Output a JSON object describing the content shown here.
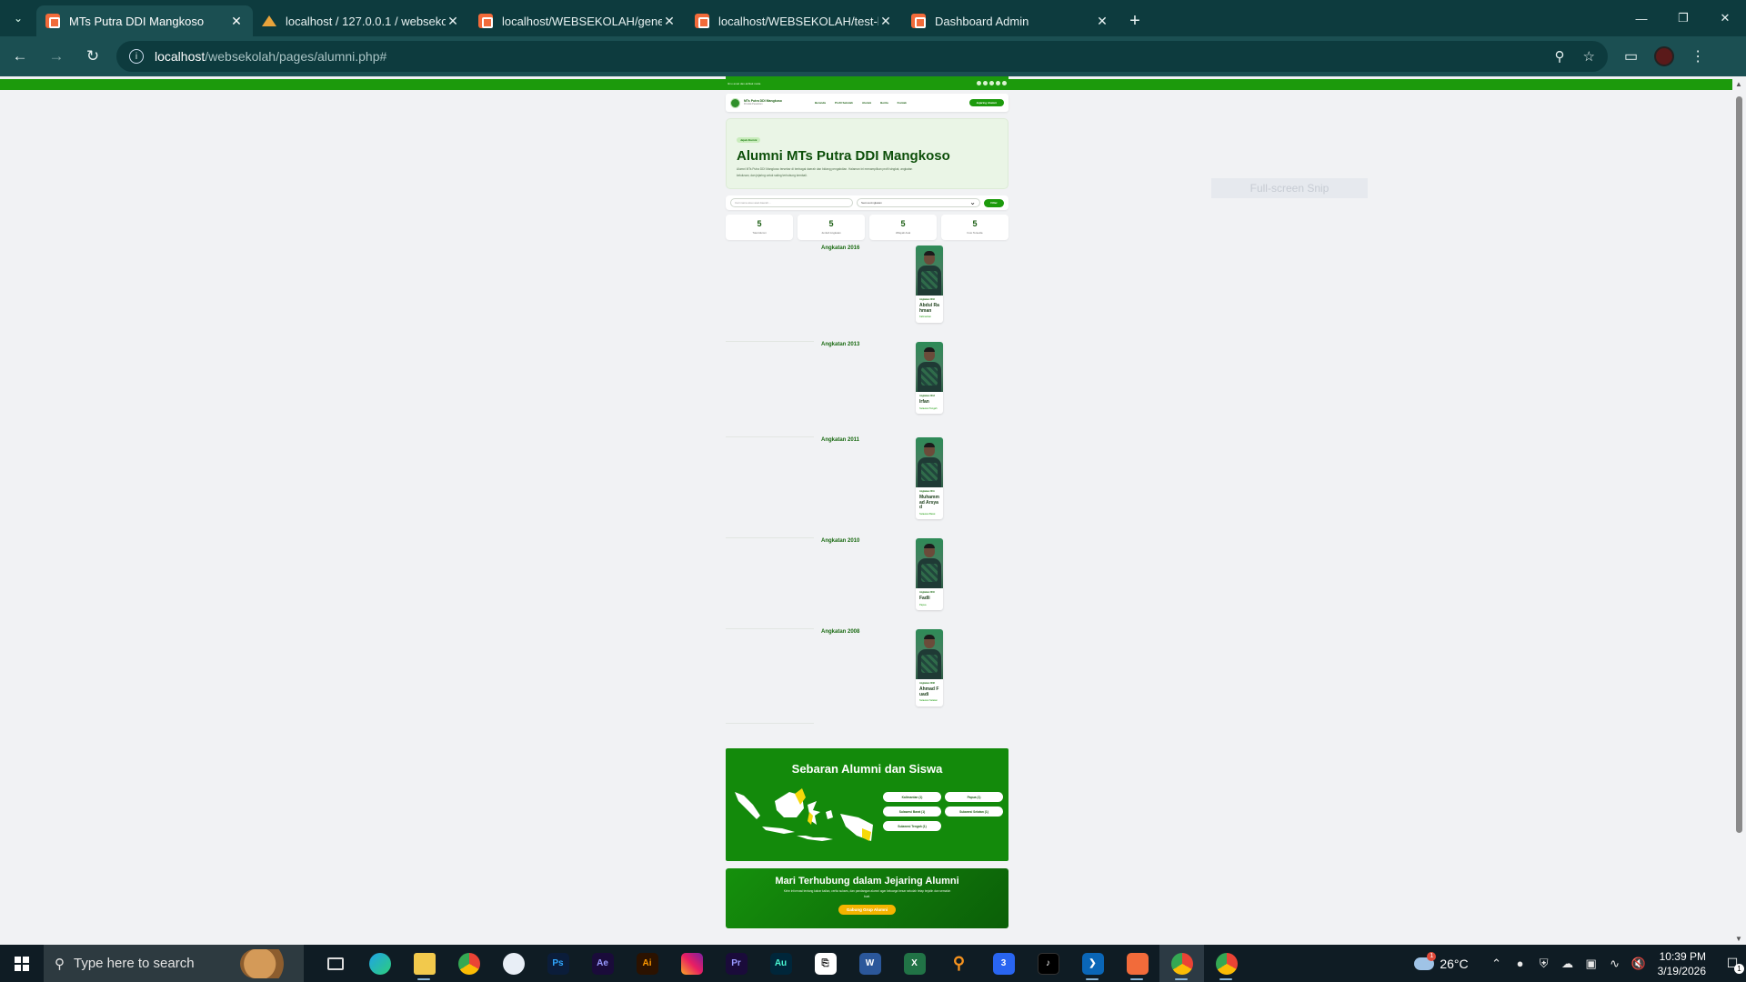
{
  "browser": {
    "tabs": [
      {
        "title": "MTs Putra DDI Mangkoso",
        "icon": "xampp-icon"
      },
      {
        "title": "localhost / 127.0.0.1 / websekolah",
        "icon": "phpmyadmin-icon"
      },
      {
        "title": "localhost/WEBSEKOLAH/generate",
        "icon": "xampp-icon"
      },
      {
        "title": "localhost/WEBSEKOLAH/test-koneksi",
        "icon": "xampp-icon"
      },
      {
        "title": "Dashboard Admin",
        "icon": "xampp-icon"
      }
    ],
    "url_host": "localhost",
    "url_path": "/websekolah/pages/alumni.php#",
    "ghost_overlay": "Full-screen Snip"
  },
  "site": {
    "topbar_tagline": "Ilmu amal dan akhlak mulia",
    "brand_name": "MTs Putra DDI Mangkoso",
    "brand_sub": "Pondok Pesantren",
    "menu": [
      "Beranda",
      "Profil Sekolah",
      "Alumni",
      "Berita",
      "Kontak"
    ],
    "cta": "Jejaring Alumni"
  },
  "hero": {
    "badge": "Jejak Alumni",
    "title": "Alumni MTs Putra DDI Mangkoso",
    "description": "Alumni MTs Putra DDI Mangkoso tersebar di berbagai daerah dan bidang pengabdian. Halaman ini menampilkan profil singkat, angkatan kelulusan, dan jejaring untuk saling terhubung kembali."
  },
  "filter": {
    "search_placeholder": "Cari nama atau asal daerah...",
    "select_value": "Semua Angkatan",
    "button": "Filter"
  },
  "stats": [
    {
      "value": "5",
      "label": "Total Alumni"
    },
    {
      "value": "5",
      "label": "Jumlah Angkatan"
    },
    {
      "value": "5",
      "label": "Wilayah Asal"
    },
    {
      "value": "5",
      "label": "Foto Tersedia"
    }
  ],
  "cohorts": [
    {
      "year": "Angkatan 2016",
      "tag": "Angkatan 2016",
      "name": "Abdul Rahman",
      "location": "Kalimantan"
    },
    {
      "year": "Angkatan 2013",
      "tag": "Angkatan 2013",
      "name": "Irfan",
      "location": "Sulawesi Tengah"
    },
    {
      "year": "Angkatan 2011",
      "tag": "Angkatan 2011",
      "name": "Muhammad Arsyad",
      "location": "Sulawesi Barat"
    },
    {
      "year": "Angkatan 2010",
      "tag": "Angkatan 2010",
      "name": "Fadli",
      "location": "Papua"
    },
    {
      "year": "Angkatan 2008",
      "tag": "Angkatan 2008",
      "name": "Ahmad Fuadi",
      "location": "Sulawesi Selatan"
    }
  ],
  "map": {
    "title": "Sebaran Alumni dan Siswa",
    "provinces": [
      "Kalimantan (1)",
      "Papua (1)",
      "Sulawesi Barat (1)",
      "Sulawesi Selatan (1)",
      "Sulawesi Tengah (1)"
    ],
    "colors": {
      "land": "#ffffff",
      "highlight": "#f5d90a",
      "panel": "#138a0b"
    }
  },
  "network": {
    "title": "Mari Terhubung dalam Jejaring Alumni",
    "text": "Kirim informasi tentang kabar kalian, cerita sukses, dan pandangan alumni agar keluarga besar sekolah tetap terjalin dan semakin kuat.",
    "button": "Gabung Grup Alumni"
  },
  "taskbar": {
    "search_placeholder": "Type here to search",
    "weather_temp": "26°C",
    "time": "10:39 PM",
    "date": "3/19/2026"
  }
}
